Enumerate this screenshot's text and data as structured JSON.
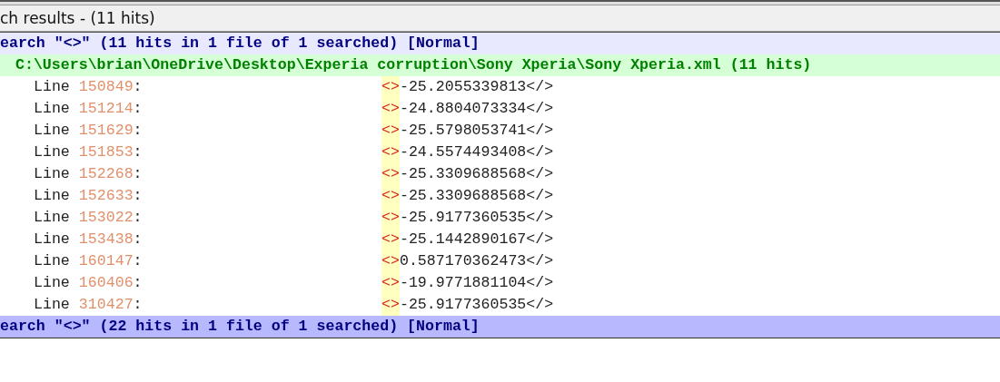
{
  "panel": {
    "title": "ch results - (11 hits)"
  },
  "searches": [
    {
      "header": "earch \"<>\" (11 hits in 1 file of 1 searched) [Normal]",
      "selected": false,
      "files": [
        {
          "path": "C:\\Users\\brian\\OneDrive\\Desktop\\Experia corruption\\Sony Xperia\\Sony Xperia.xml (11 hits)",
          "lines": [
            {
              "label": "Line",
              "number": "150849",
              "colon": ":",
              "match": "<>",
              "rest": "-25.2055339813</>"
            },
            {
              "label": "Line",
              "number": "151214",
              "colon": ":",
              "match": "<>",
              "rest": "-24.8804073334</>"
            },
            {
              "label": "Line",
              "number": "151629",
              "colon": ":",
              "match": "<>",
              "rest": "-25.5798053741</>"
            },
            {
              "label": "Line",
              "number": "151853",
              "colon": ":",
              "match": "<>",
              "rest": "-24.5574493408</>"
            },
            {
              "label": "Line",
              "number": "152268",
              "colon": ":",
              "match": "<>",
              "rest": "-25.3309688568</>"
            },
            {
              "label": "Line",
              "number": "152633",
              "colon": ":",
              "match": "<>",
              "rest": "-25.3309688568</>"
            },
            {
              "label": "Line",
              "number": "153022",
              "colon": ":",
              "match": "<>",
              "rest": "-25.9177360535</>"
            },
            {
              "label": "Line",
              "number": "153438",
              "colon": ":",
              "match": "<>",
              "rest": "-25.1442890167</>"
            },
            {
              "label": "Line",
              "number": "160147",
              "colon": ":",
              "match": "<>",
              "rest": "0.587170362473</>"
            },
            {
              "label": "Line",
              "number": "160406",
              "colon": ":",
              "match": "<>",
              "rest": "-19.9771881104</>"
            },
            {
              "label": "Line",
              "number": "310427",
              "colon": ":",
              "match": "<>",
              "rest": "-25.9177360535</>"
            }
          ]
        }
      ]
    },
    {
      "header": "earch \"<>\" (22 hits in 1 file of 1 searched) [Normal]",
      "selected": true
    }
  ]
}
